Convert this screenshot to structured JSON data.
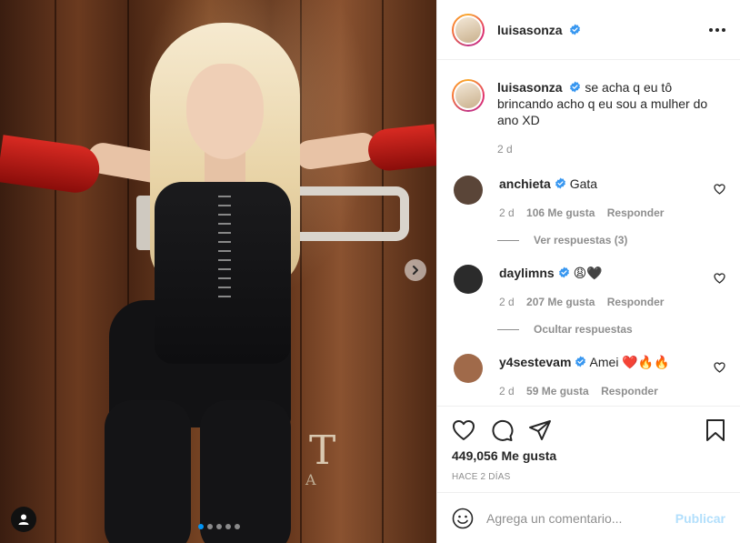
{
  "post": {
    "username": "luisasonza",
    "caption": "se acha q eu tô brincando acho q eu sou a mulher do ano XD",
    "caption_time": "2 d",
    "likes": "449,056 Me gusta",
    "date": "HACE 2 DÍAS",
    "image_letters": {
      "t": "T",
      "a": "A"
    },
    "carousel": {
      "total": 5,
      "active": 1
    }
  },
  "comments": [
    {
      "username": "anchieta",
      "text": "Gata",
      "emoji": "",
      "time": "2 d",
      "likes": "106 Me gusta",
      "reply_label": "Responder",
      "replies_toggle": "Ver respuestas (3)",
      "avatar_color": "#5a4538"
    },
    {
      "username": "daylimns",
      "text": "",
      "emoji": "😩🖤",
      "time": "2 d",
      "likes": "207 Me gusta",
      "reply_label": "Responder",
      "replies_toggle": "Ocultar respuestas",
      "avatar_color": "#2b2b2b"
    },
    {
      "username": "y4sestevam",
      "text": "Amei",
      "emoji": "❤️🔥🔥",
      "time": "2 d",
      "likes": "59 Me gusta",
      "reply_label": "Responder",
      "replies_toggle": "",
      "avatar_color": "#a06a4a"
    }
  ],
  "add_comment": {
    "placeholder": "Agrega un comentario...",
    "publish_label": "Publicar"
  },
  "colors": {
    "verified": "#3897f0",
    "link_disabled": "#b2dffc",
    "meta_gray": "#8e8e8e"
  },
  "icons": [
    "heart-icon",
    "comment-icon",
    "share-icon",
    "save-icon",
    "emoji-icon",
    "more-options-icon",
    "verified-icon",
    "next-arrow-icon",
    "user-tag-icon"
  ]
}
